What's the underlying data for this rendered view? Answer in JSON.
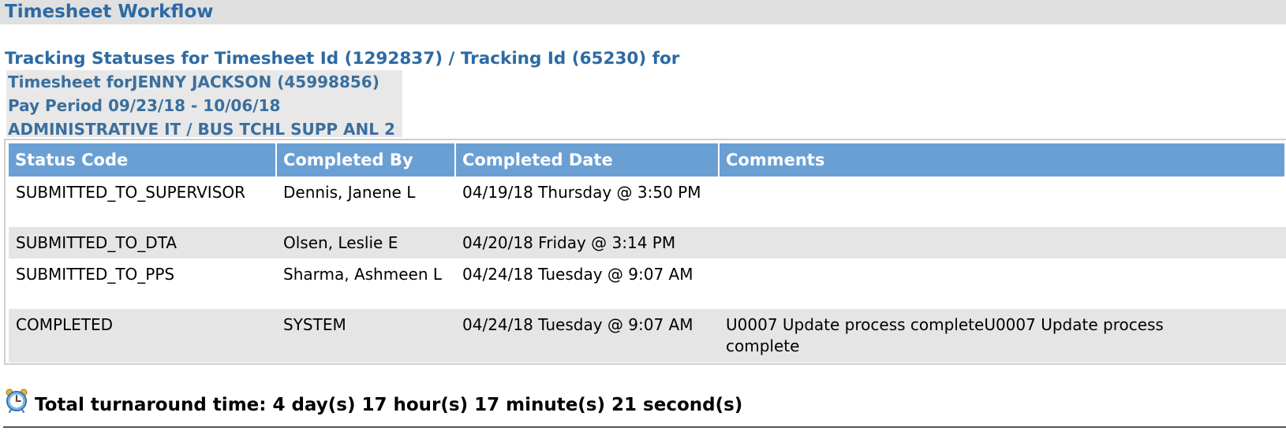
{
  "page": {
    "title": "Timesheet Workflow",
    "tracking_heading": "Tracking Statuses for Timesheet Id (1292837) / Tracking Id (65230) for"
  },
  "info": {
    "line1": "Timesheet forJENNY JACKSON (45998856)",
    "line2": "Pay Period 09/23/18 - 10/06/18",
    "line3": "ADMINISTRATIVE IT / BUS TCHL SUPP ANL 2"
  },
  "table": {
    "headers": [
      "Status Code",
      "Completed By",
      "Completed Date",
      "Comments"
    ],
    "rows": [
      {
        "status": "SUBMITTED_TO_SUPERVISOR",
        "by": "Dennis, Janene L",
        "date": "04/19/18 Thursday @ 3:50 PM",
        "comments": ""
      },
      {
        "status": "SUBMITTED_TO_DTA",
        "by": "Olsen, Leslie E",
        "date": "04/20/18 Friday @ 3:14 PM",
        "comments": ""
      },
      {
        "status": "SUBMITTED_TO_PPS",
        "by": "Sharma, Ashmeen L",
        "date": "04/24/18 Tuesday @ 9:07 AM",
        "comments": ""
      },
      {
        "status": "COMPLETED",
        "by": "SYSTEM",
        "date": "04/24/18 Tuesday @ 9:07 AM",
        "comments": "U0007 Update process completeU0007 Update process complete"
      }
    ]
  },
  "footer": {
    "icon": "alarm-clock-icon",
    "total_turnaround": "Total turnaround time: 4 day(s) 17 hour(s) 17 minute(s) 21 second(s)"
  },
  "colors": {
    "title_blue": "#2d6aa3",
    "header_bg": "#6a9fd4",
    "row_shade": "#e5e5e5",
    "title_bar_bg": "#e0e0e0"
  }
}
